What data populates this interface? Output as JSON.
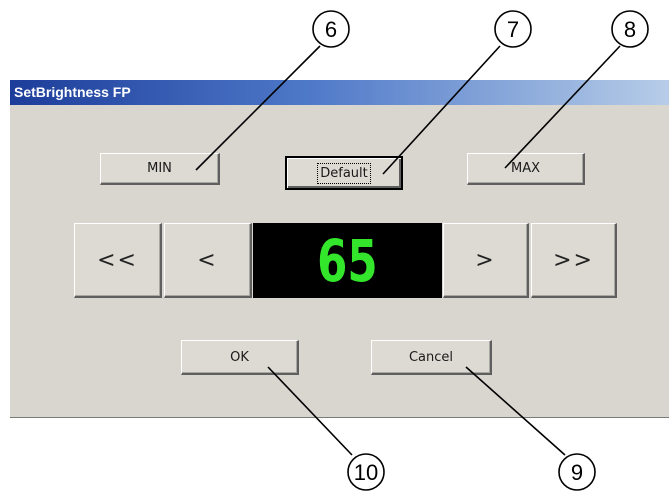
{
  "window": {
    "title": "SetBrightness FP"
  },
  "buttons": {
    "min": "MIN",
    "default": "Default",
    "max": "MAX",
    "step_down_large": "<<",
    "step_down": "<",
    "step_up": ">",
    "step_up_large": ">>",
    "ok": "OK",
    "cancel": "Cancel"
  },
  "display": {
    "value": "65",
    "color": "#33e62b"
  },
  "callouts": [
    "6",
    "7",
    "8",
    "9",
    "10"
  ],
  "colors": {
    "dialog_bg": "#d8d6cf",
    "title_start": "#1c3d9a",
    "display_bg": "#000000"
  }
}
